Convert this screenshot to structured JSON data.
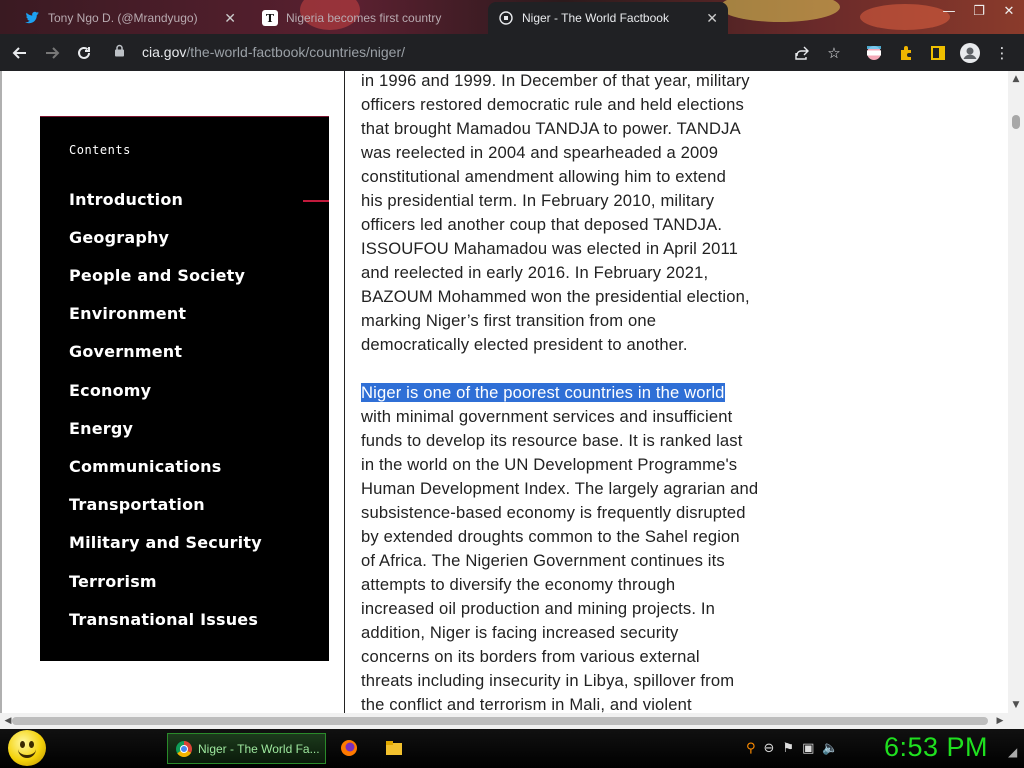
{
  "browser": {
    "tabs": [
      {
        "title": "Tony Ngo D. (@Mrandyugo)",
        "icon": "twitter-icon",
        "active": false
      },
      {
        "title": "Nigeria becomes first country",
        "icon": "telegraph-icon",
        "active": false
      },
      {
        "title": "Niger - The World Factbook",
        "icon": "cia-icon",
        "active": true
      }
    ],
    "url_host": "cia.gov",
    "url_path": "/the-world-factbook/countries/niger/"
  },
  "sidebar": {
    "title": "Contents",
    "items": [
      {
        "label": "Introduction"
      },
      {
        "label": "Geography"
      },
      {
        "label": "People and Society"
      },
      {
        "label": "Environment"
      },
      {
        "label": "Government"
      },
      {
        "label": "Economy"
      },
      {
        "label": "Energy"
      },
      {
        "label": "Communications"
      },
      {
        "label": "Transportation"
      },
      {
        "label": "Military and Security"
      },
      {
        "label": "Terrorism"
      },
      {
        "label": "Transnational Issues"
      }
    ]
  },
  "article": {
    "para1": [
      "in 1996 and 1999. In December of that year, military",
      "officers restored democratic rule and held elections",
      "that brought Mamadou TANDJA to power. TANDJA",
      "was reelected in 2004 and spearheaded a 2009",
      "constitutional amendment allowing him to extend",
      "his presidential term. In February 2010, military",
      "officers led another coup that deposed TANDJA.",
      "ISSOUFOU Mahamadou was elected in April 2011",
      "and reelected in early 2016. In February 2021,",
      "BAZOUM Mohammed won the presidential election,",
      "marking Niger’s first transition from one",
      "democratically elected president to another."
    ],
    "highlight": "Niger is one of the poorest countries in the world",
    "para2": [
      "with minimal government services and insufficient",
      "funds to develop its resource base. It is ranked last",
      "in the world on the UN Development Programme's",
      "Human Development Index. The largely agrarian and",
      "subsistence-based economy is frequently disrupted",
      "by extended droughts common to the Sahel region",
      "of Africa. The Nigerien Government continues its",
      "attempts to diversify the economy through",
      "increased oil production and mining projects. In",
      "addition, Niger is facing increased security",
      "concerns on its borders from various external",
      "threats including insecurity in Libya, spillover from",
      "the conflict and terrorism in Mali, and violent"
    ]
  },
  "taskbar": {
    "window_label": "Niger - The World Fa...",
    "clock": "6:53 PM"
  },
  "colors": {
    "highlight_bg": "#2f6fd6",
    "toc_accent": "#c21a3c",
    "clock": "#1fe01f"
  }
}
